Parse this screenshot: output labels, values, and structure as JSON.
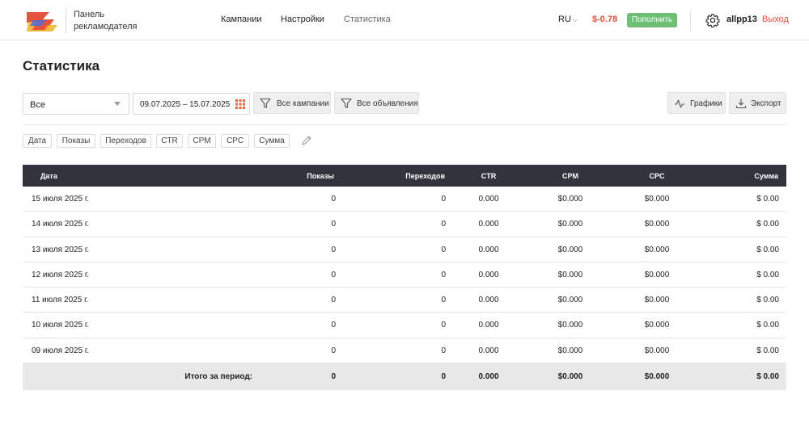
{
  "header": {
    "brand_line1": "Панель",
    "brand_line2": "рекламодателя",
    "nav": [
      "Кампании",
      "Настройки",
      "Статистика"
    ],
    "active_nav": "Статистика",
    "lang": "RU",
    "balance": "$-0.78",
    "topup_label": "Пополнить",
    "username": "allpp13",
    "logout_label": "Выход"
  },
  "page": {
    "title": "Статистика"
  },
  "filters": {
    "type_select": "Все",
    "date_range": "09.07.2025 – 15.07.2025",
    "campaigns_button": "Все кампании",
    "ads_button": "Все объявления",
    "charts_button": "Графики",
    "export_button": "Экспорт"
  },
  "columns_chips": [
    "Дата",
    "Показы",
    "Переходов",
    "CTR",
    "CPM",
    "CPC",
    "Сумма"
  ],
  "table": {
    "headers": [
      "Дата",
      "Показы",
      "Переходов",
      "CTR",
      "CPM",
      "CPC",
      "Сумма"
    ],
    "rows": [
      [
        "15 июля 2025 г.",
        "0",
        "0",
        "0.000",
        "$0.000",
        "$0.000",
        "$ 0.00"
      ],
      [
        "14 июля 2025 г.",
        "0",
        "0",
        "0.000",
        "$0.000",
        "$0.000",
        "$ 0.00"
      ],
      [
        "13 июля 2025 г.",
        "0",
        "0",
        "0.000",
        "$0.000",
        "$0.000",
        "$ 0.00"
      ],
      [
        "12 июля 2025 г.",
        "0",
        "0",
        "0.000",
        "$0.000",
        "$0.000",
        "$ 0.00"
      ],
      [
        "11 июля 2025 г.",
        "0",
        "0",
        "0.000",
        "$0.000",
        "$0.000",
        "$ 0.00"
      ],
      [
        "10 июля 2025 г.",
        "0",
        "0",
        "0.000",
        "$0.000",
        "$0.000",
        "$ 0.00"
      ],
      [
        "09 июля 2025 г.",
        "0",
        "0",
        "0.000",
        "$0.000",
        "$0.000",
        "$ 0.00"
      ]
    ],
    "total": [
      "Итого за период:",
      "0",
      "0",
      "0.000",
      "$0.000",
      "$0.000",
      "$ 0.00"
    ]
  },
  "colors": {
    "accent_red": "#e0533b",
    "topup_green": "#6cbf74",
    "table_header": "#33333d"
  }
}
